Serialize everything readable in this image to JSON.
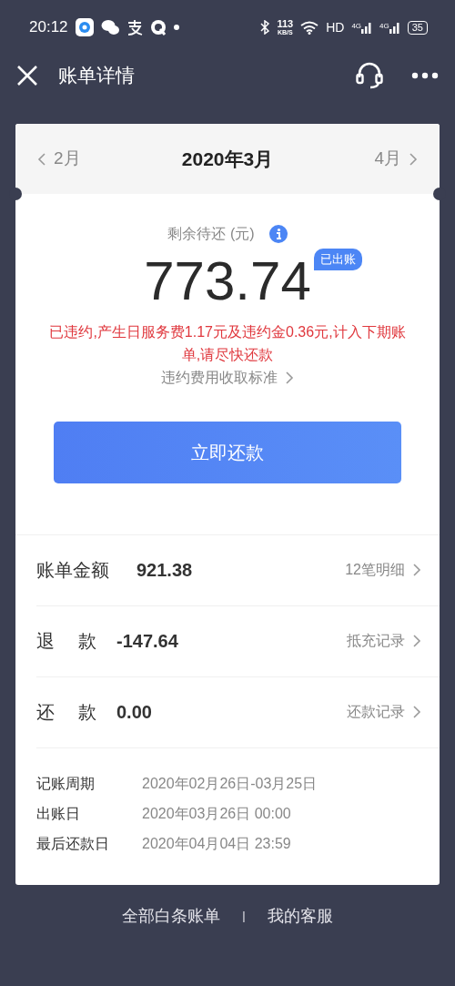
{
  "status_bar": {
    "time": "20:12",
    "speed_value": "113",
    "speed_unit": "KB/S",
    "hd": "HD",
    "network_1": "4G",
    "network_2": "4G",
    "battery": "35"
  },
  "nav": {
    "title": "账单详情"
  },
  "months": {
    "prev": "2月",
    "current": "2020年3月",
    "next": "4月"
  },
  "summary": {
    "label": "剩余待还 (元)",
    "amount": "773.74",
    "badge": "已出账",
    "warning": "已违约,产生日服务费1.17元及违约金0.36元,计入下期账单,请尽快还款",
    "link": "违约费用收取标准"
  },
  "pay_button": "立即还款",
  "rows": [
    {
      "label": "账单金额",
      "value": "921.38",
      "link": "12笔明细",
      "spaced": false
    },
    {
      "label": "退款",
      "value": "-147.64",
      "link": "抵充记录",
      "spaced": true
    },
    {
      "label": "还款",
      "value": "0.00",
      "link": "还款记录",
      "spaced": true
    }
  ],
  "details": [
    {
      "label": "记账周期",
      "value": "2020年02月26日-03月25日"
    },
    {
      "label": "出账日",
      "value": "2020年03月26日 00:00"
    },
    {
      "label": "最后还款日",
      "value": "2020年04月04日 23:59"
    }
  ],
  "footer": {
    "left": "全部白条账单",
    "separator": "|",
    "right": "我的客服"
  }
}
